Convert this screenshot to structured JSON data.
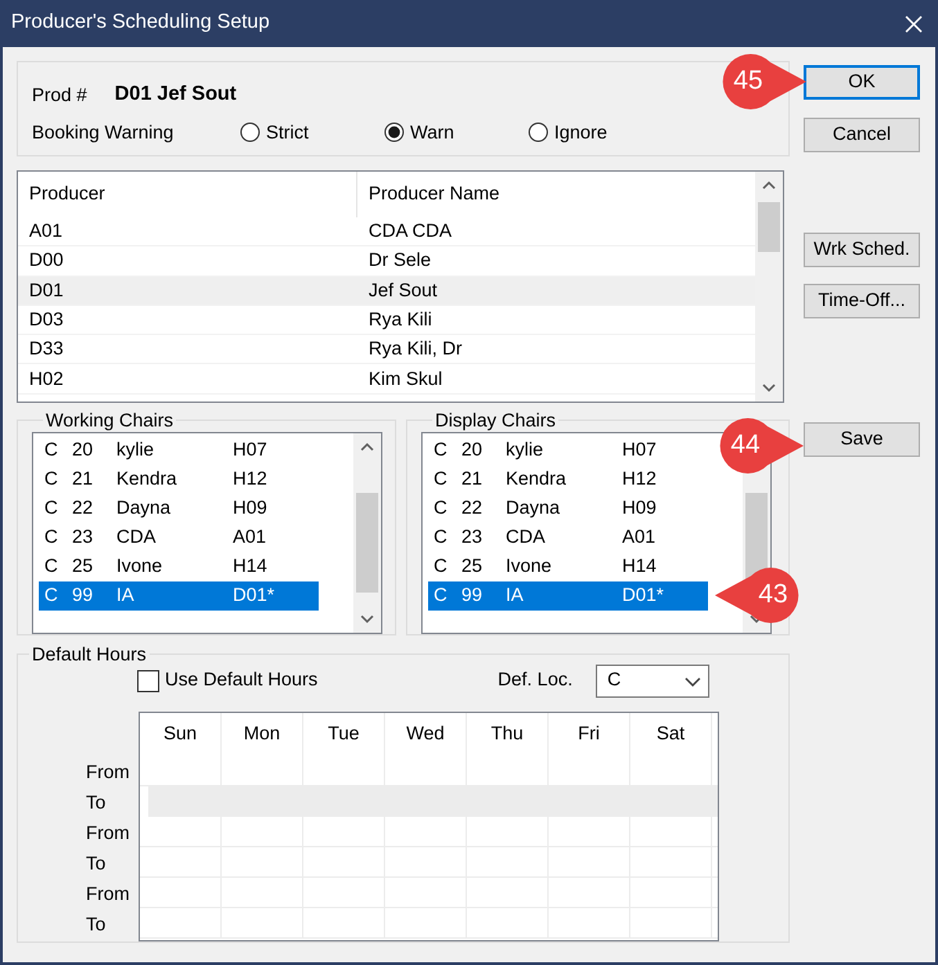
{
  "window": {
    "title": "Producer's Scheduling Setup"
  },
  "header": {
    "prod_label": "Prod #",
    "prod_value": "D01 Jef Sout",
    "booking_label": "Booking Warning",
    "options": [
      {
        "label": "Strict",
        "selected": false
      },
      {
        "label": "Warn",
        "selected": true
      },
      {
        "label": "Ignore",
        "selected": false
      }
    ]
  },
  "producers": {
    "columns": [
      "Producer",
      "Producer Name"
    ],
    "rows": [
      {
        "code": "A01",
        "name": "CDA CDA",
        "selected": false
      },
      {
        "code": "D00",
        "name": "Dr Sele",
        "selected": false
      },
      {
        "code": "D01",
        "name": "Jef Sout",
        "selected": true
      },
      {
        "code": "D03",
        "name": "Rya Kili",
        "selected": false
      },
      {
        "code": "D33",
        "name": "Rya Kili, Dr",
        "selected": false
      },
      {
        "code": "H02",
        "name": "Kim Skul",
        "selected": false
      }
    ]
  },
  "chair_lists": [
    {
      "title": "Working Chairs",
      "rows": [
        {
          "cells": [
            "C",
            "20",
            "kylie",
            "H07"
          ],
          "selected": false
        },
        {
          "cells": [
            "C",
            "21",
            "Kendra",
            "H12"
          ],
          "selected": false
        },
        {
          "cells": [
            "C",
            "22",
            "Dayna",
            "H09"
          ],
          "selected": false
        },
        {
          "cells": [
            "C",
            "23",
            "CDA",
            "A01"
          ],
          "selected": false
        },
        {
          "cells": [
            "C",
            "25",
            "Ivone",
            "H14"
          ],
          "selected": false
        },
        {
          "cells": [
            "C",
            "99",
            "IA",
            "D01*"
          ],
          "selected": true
        }
      ]
    },
    {
      "title": "Display Chairs",
      "rows": [
        {
          "cells": [
            "C",
            "20",
            "kylie",
            "H07"
          ],
          "selected": false
        },
        {
          "cells": [
            "C",
            "21",
            "Kendra",
            "H12"
          ],
          "selected": false
        },
        {
          "cells": [
            "C",
            "22",
            "Dayna",
            "H09"
          ],
          "selected": false
        },
        {
          "cells": [
            "C",
            "23",
            "CDA",
            "A01"
          ],
          "selected": false
        },
        {
          "cells": [
            "C",
            "25",
            "Ivone",
            "H14"
          ],
          "selected": false
        },
        {
          "cells": [
            "C",
            "99",
            "IA",
            "D01*"
          ],
          "selected": true
        }
      ]
    }
  ],
  "default_hours": {
    "title": "Default Hours",
    "use_default": {
      "label": "Use Default Hours",
      "checked": false
    },
    "def_loc": {
      "label": "Def. Loc.",
      "value": "C"
    },
    "days": [
      "Sun",
      "Mon",
      "Tue",
      "Wed",
      "Thu",
      "Fri",
      "Sat"
    ],
    "rows": [
      {
        "label": "From",
        "selected": false
      },
      {
        "label": "To",
        "selected": true
      },
      {
        "label": "From",
        "selected": false
      },
      {
        "label": "To",
        "selected": false
      },
      {
        "label": "From",
        "selected": false
      },
      {
        "label": "To",
        "selected": false
      }
    ]
  },
  "buttons": [
    {
      "label": "OK",
      "kind": "default"
    },
    {
      "label": "Cancel",
      "kind": "normal"
    },
    {
      "label": "Wrk Sched.",
      "kind": "normal"
    },
    {
      "label": "Time-Off...",
      "kind": "normal"
    },
    {
      "label": "Save",
      "kind": "normal"
    }
  ],
  "callouts": [
    {
      "text": "45"
    },
    {
      "text": "44"
    },
    {
      "text": "43"
    }
  ]
}
